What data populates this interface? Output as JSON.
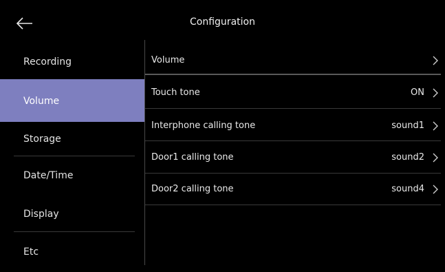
{
  "header": {
    "title": "Configuration",
    "back_icon": "arrow-left-icon"
  },
  "sidebar": {
    "items": [
      {
        "label": "Recording",
        "active": false
      },
      {
        "label": "Volume",
        "active": true
      },
      {
        "label": "Storage",
        "active": false
      },
      {
        "label": "Date/Time",
        "active": false
      },
      {
        "label": "Display",
        "active": false
      },
      {
        "label": "Etc",
        "active": false
      }
    ],
    "active_color": "#7e7fbf"
  },
  "main": {
    "rows": [
      {
        "label": "Volume",
        "value": ""
      },
      {
        "label": "Touch tone",
        "value": "ON"
      },
      {
        "label": "Interphone calling tone",
        "value": "sound1"
      },
      {
        "label": "Door1 calling tone",
        "value": "sound2"
      },
      {
        "label": "Door2 calling tone",
        "value": "sound4"
      }
    ],
    "chevron_icon": "chevron-right-icon"
  }
}
